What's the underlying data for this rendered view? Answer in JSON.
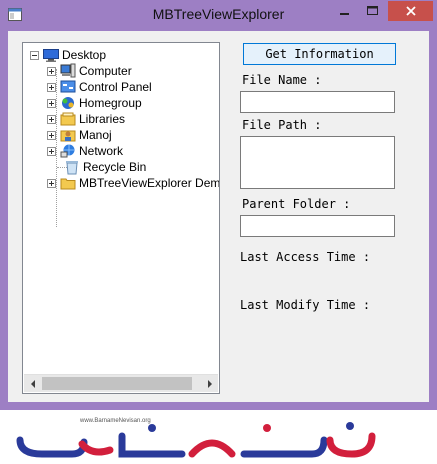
{
  "window": {
    "title": "MBTreeViewExplorer",
    "colors": {
      "frame": "#9d7fc4",
      "close": "#c7504b",
      "client": "#f0f0f0"
    }
  },
  "tree": {
    "root": {
      "label": "Desktop",
      "icon": "desktop-icon",
      "expanded": true
    },
    "children": [
      {
        "label": "Computer",
        "icon": "computer-icon",
        "expandable": true
      },
      {
        "label": "Control Panel",
        "icon": "control-panel-icon",
        "expandable": true
      },
      {
        "label": "Homegroup",
        "icon": "homegroup-icon",
        "expandable": true
      },
      {
        "label": "Libraries",
        "icon": "libraries-icon",
        "expandable": true
      },
      {
        "label": "Manoj",
        "icon": "user-folder-icon",
        "expandable": true
      },
      {
        "label": "Network",
        "icon": "network-icon",
        "expandable": true
      },
      {
        "label": "Recycle Bin",
        "icon": "recycle-bin-icon",
        "expandable": false
      },
      {
        "label": "MBTreeViewExplorer Demo",
        "icon": "folder-icon",
        "expandable": true
      }
    ]
  },
  "panel": {
    "get_info_label": "Get Information",
    "file_name_label": "File Name :",
    "file_name_value": "",
    "file_path_label": "File Path :",
    "file_path_value": "",
    "parent_folder_label": "Parent Folder :",
    "parent_folder_value": "",
    "last_access_label": "Last Access Time :",
    "last_modify_label": "Last Modify Time :"
  },
  "banner": {
    "url": "www.BarnameNevisan.org",
    "logo_text": "برنامه نویسان"
  }
}
